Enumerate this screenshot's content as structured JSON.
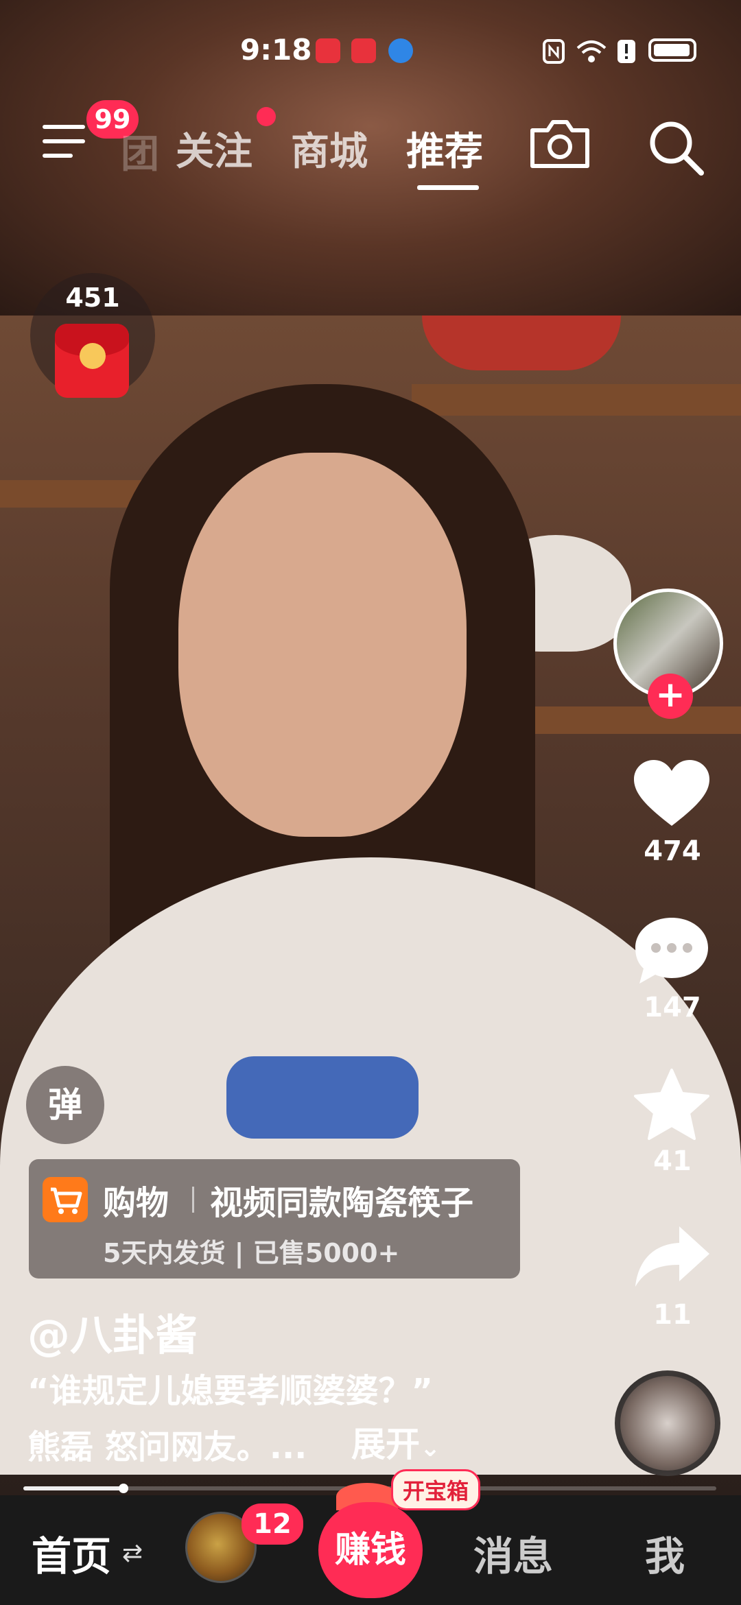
{
  "status_bar": {
    "time": "9:18",
    "app_icons": [
      "huawei-app-icon",
      "huawei-app-icon",
      "browser-app-icon"
    ],
    "right_icons": [
      "nfc-icon",
      "wifi-icon",
      "alert-icon",
      "battery-icon"
    ]
  },
  "top_nav": {
    "menu_badge": "99",
    "tabs": [
      {
        "label": "关注",
        "active": false
      },
      {
        "label": "商城",
        "active": false
      },
      {
        "label": "推荐",
        "active": true
      }
    ],
    "partial_tab": "团"
  },
  "red_packet": {
    "count": "451"
  },
  "actions": {
    "likes": "474",
    "comments": "147",
    "favorites": "41",
    "shares": "11"
  },
  "danmu": {
    "label": "弹"
  },
  "shop_card": {
    "tag": "购物",
    "title": "视频同款陶瓷筷子",
    "subtitle": "5天内发货 | 已售5000+"
  },
  "caption": {
    "username": "@八卦酱",
    "line1": "“谁规定儿媳要孝顺婆婆？”",
    "line2": "熊磊 怒问网友。...",
    "expand": "展开"
  },
  "progress": {
    "fraction": 0.145
  },
  "bottom_nav": {
    "home": "首页",
    "avatar_badge": "12",
    "earn": "赚钱",
    "treasure": "开宝箱",
    "messages": "消息",
    "me": "我"
  },
  "colors": {
    "accent": "#ff2c55",
    "cart": "#ff7a1a",
    "nav_bg": "#1a1a1a"
  }
}
